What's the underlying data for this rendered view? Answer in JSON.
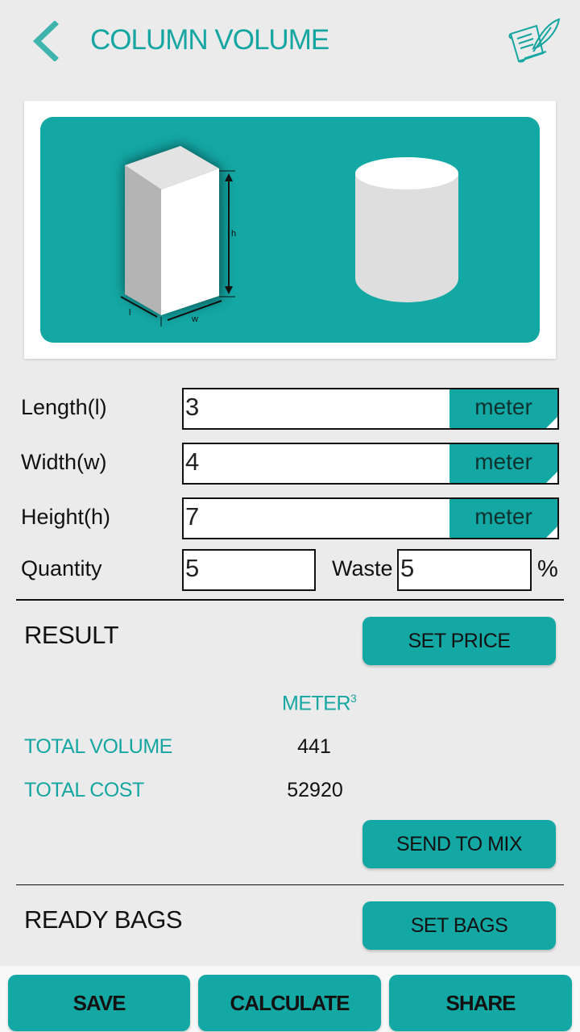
{
  "header": {
    "title": "COLUMN VOLUME",
    "back_icon": "chevron-left-icon",
    "notes_icon": "scroll-quill-icon"
  },
  "illustration": {
    "shapes": [
      "rectangular-prism",
      "cylinder"
    ],
    "dimension_labels": {
      "height": "h",
      "length": "l",
      "width": "w"
    }
  },
  "inputs": {
    "length": {
      "label": "Length(l)",
      "value": "3",
      "unit": "meter"
    },
    "width": {
      "label": "Width(w)",
      "value": "4",
      "unit": "meter"
    },
    "height": {
      "label": "Height(h)",
      "value": "7",
      "unit": "meter"
    },
    "quantity": {
      "label": "Quantity",
      "value": "5"
    },
    "waste": {
      "label": "Waste",
      "value": "5",
      "suffix": "%"
    }
  },
  "result": {
    "title": "RESULT",
    "set_price_label": "SET PRICE",
    "unit_header": "METER",
    "unit_superscript": "3",
    "total_volume_label": "TOTAL VOLUME",
    "total_volume_value": "441",
    "total_cost_label": "TOTAL COST",
    "total_cost_value": "52920",
    "send_to_mix_label": "SEND TO MIX"
  },
  "ready_bags": {
    "title": "READY BAGS",
    "set_bags_label": "SET BAGS"
  },
  "bottom_bar": {
    "save_label": "SAVE",
    "calculate_label": "CALCULATE",
    "share_label": "SHARE"
  },
  "colors": {
    "accent": "#14a8a5",
    "background": "#ebebeb"
  }
}
